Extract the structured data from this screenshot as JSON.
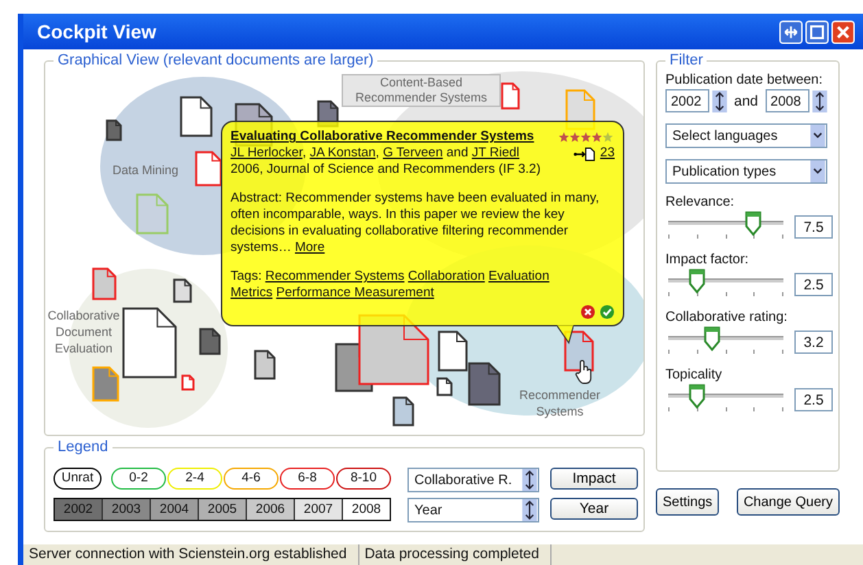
{
  "window": {
    "title": "Cockpit View"
  },
  "graphical_view": {
    "title": "Graphical View (relevant documents are larger)",
    "clusters": [
      {
        "label": "Data Mining"
      },
      {
        "label": "Content-Based Recommender Systems"
      },
      {
        "label": "Collaborative Document Evaluation"
      },
      {
        "label": "Recommender Systems"
      }
    ],
    "popup": {
      "title": "Evaluating Collaborative Recommender Systems",
      "authors": [
        {
          "name": "JL Herlocker",
          "separator": ","
        },
        {
          "name": "JA Konstan",
          "separator": ","
        },
        {
          "name": "G Terveen",
          "separator": "and"
        },
        {
          "name": "JT Riedl"
        }
      ],
      "meta": "2006, Journal of Science and Recommenders (IF 3.2)",
      "abstract": "Abstract: Recommender systems have been evaluated in many, often incomparable, ways. In this paper we review the key decisions in evaluating collaborative filtering recommender systems…",
      "more": "More",
      "tags_label": "Tags:",
      "tags": [
        "Recommender Systems",
        "Collaboration",
        "Evaluation",
        "Metrics",
        "Performance Measurement"
      ],
      "stars": 4,
      "citations": "23"
    }
  },
  "legend": {
    "title": "Legend",
    "ratings": [
      {
        "label": "Unrat",
        "color": "#000000"
      },
      {
        "label": "0-2",
        "color": "#22bb44"
      },
      {
        "label": "2-4",
        "color": "#eeee00"
      },
      {
        "label": "4-6",
        "color": "#f5a800"
      },
      {
        "label": "6-8",
        "color": "#e82020"
      },
      {
        "label": "8-10",
        "color": "#cc1111"
      }
    ],
    "years": [
      {
        "label": "2002",
        "color": "#6e6e6e"
      },
      {
        "label": "2003",
        "color": "#888888"
      },
      {
        "label": "2004",
        "color": "#9c9c9c"
      },
      {
        "label": "2005",
        "color": "#b0b0b0"
      },
      {
        "label": "2006",
        "color": "#c8c8c8"
      },
      {
        "label": "2007",
        "color": "#e4e4e4"
      },
      {
        "label": "2008",
        "color": "#ffffff"
      }
    ],
    "sort_fields": [
      {
        "value": "Collaborative R."
      },
      {
        "value": "Year"
      }
    ],
    "buttons": [
      "Impact",
      "Year"
    ]
  },
  "filter": {
    "title": "Filter",
    "date_label": "Publication date between:",
    "from": "2002",
    "joiner": "and",
    "to": "2008",
    "selects": [
      "Select languages",
      "Publication types"
    ],
    "sliders": [
      {
        "label": "Relevance:",
        "level": 0.74,
        "value": "7.5"
      },
      {
        "label": "Impact factor:",
        "level": 0.25,
        "value": "2.5"
      },
      {
        "label": "Collaborative rating:",
        "level": 0.38,
        "value": "3.2"
      },
      {
        "label": "Topicality",
        "level": 0.25,
        "value": "2.5"
      }
    ]
  },
  "buttons": [
    "Settings",
    "Change Query"
  ],
  "status_bar": [
    "Server connection with Scienstein.org established",
    "Data processing completed"
  ]
}
